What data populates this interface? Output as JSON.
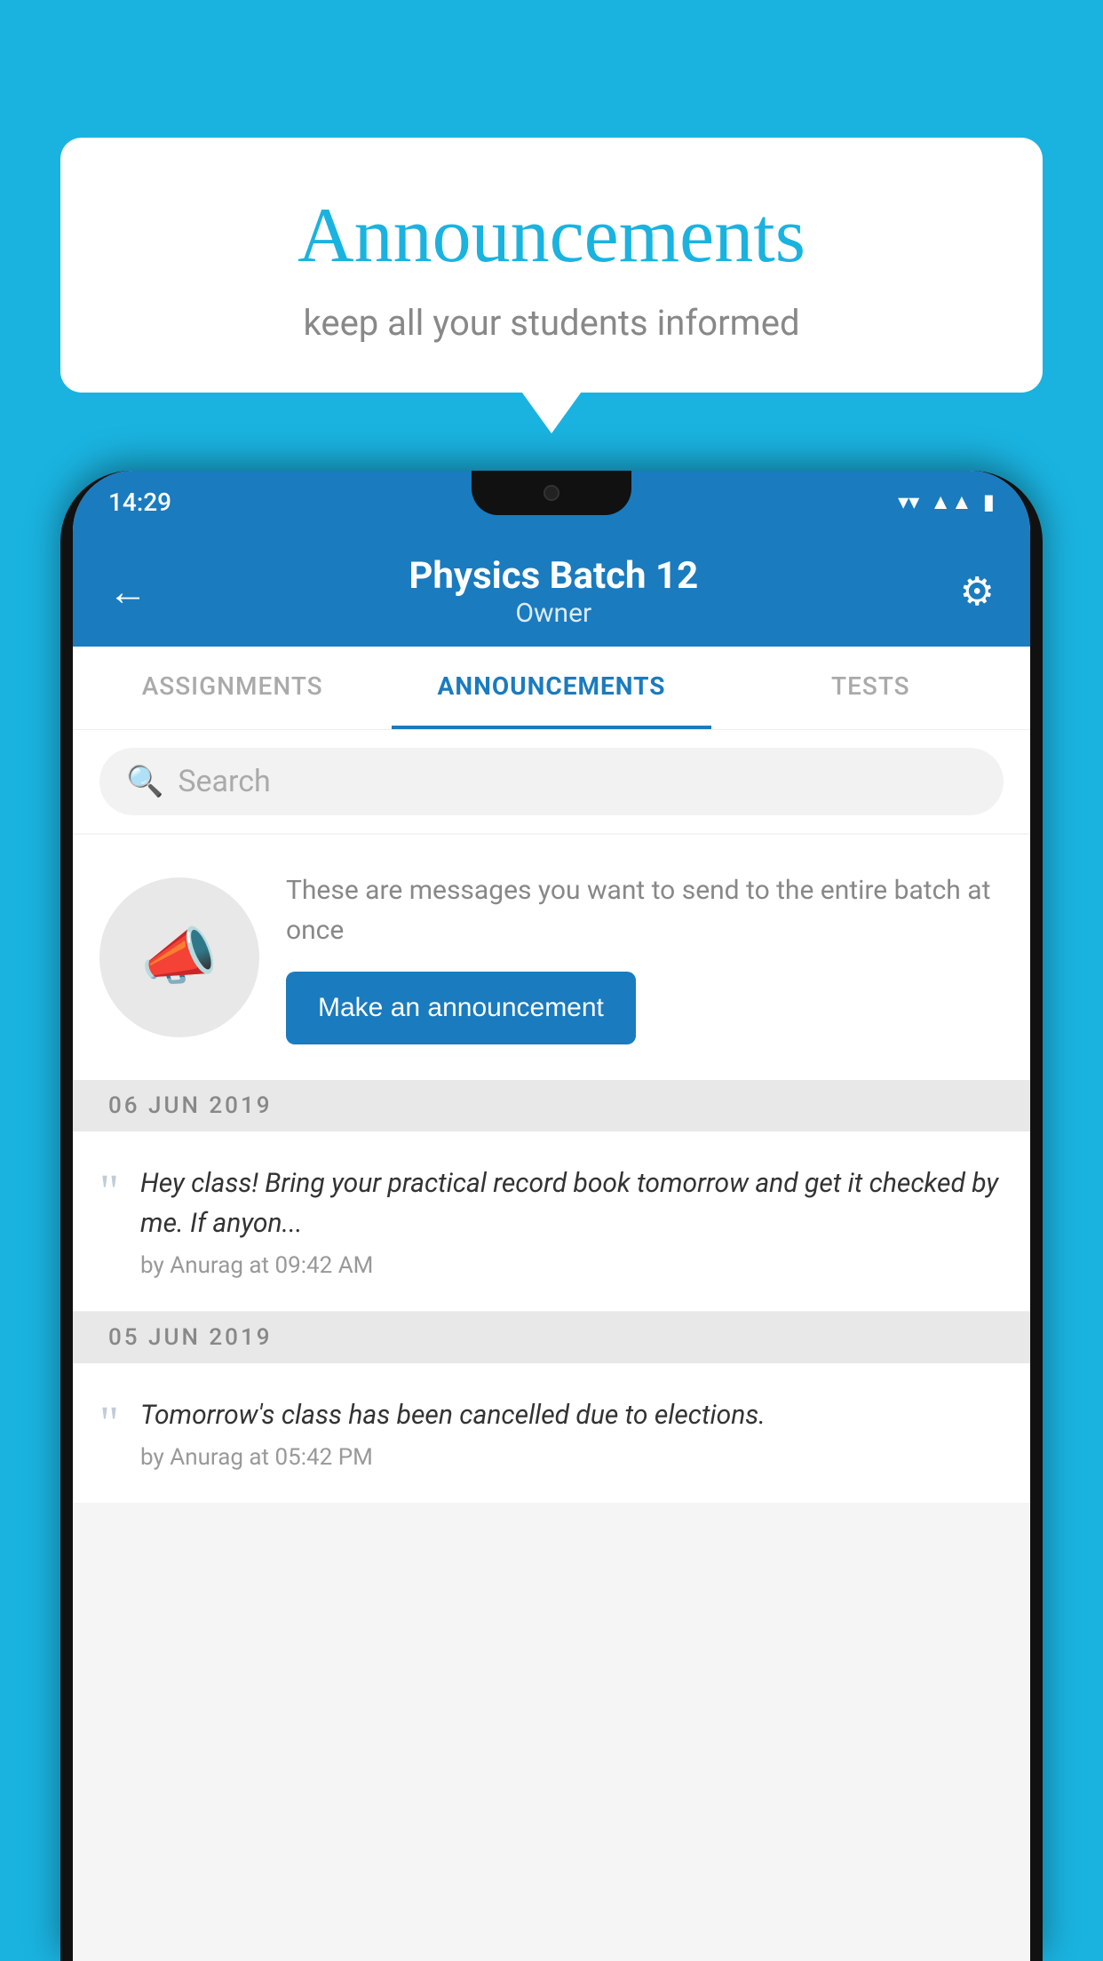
{
  "background_color": "#1ab3e0",
  "speech_bubble": {
    "title": "Announcements",
    "subtitle": "keep all your students informed"
  },
  "status_bar": {
    "time": "14:29",
    "icons": [
      "wifi",
      "signal",
      "battery"
    ]
  },
  "app_header": {
    "title": "Physics Batch 12",
    "subtitle": "Owner",
    "back_label": "←"
  },
  "tabs": [
    {
      "label": "ASSIGNMENTS",
      "active": false
    },
    {
      "label": "ANNOUNCEMENTS",
      "active": true
    },
    {
      "label": "TESTS",
      "active": false
    }
  ],
  "search": {
    "placeholder": "Search"
  },
  "announcement_prompt": {
    "description": "These are messages you want to send to the entire batch at once",
    "button_label": "Make an announcement"
  },
  "announcements": [
    {
      "date": "06  JUN  2019",
      "text": "Hey class! Bring your practical record book tomorrow and get it checked by me. If anyon...",
      "meta": "by Anurag at 09:42 AM"
    },
    {
      "date": "05  JUN  2019",
      "text": "Tomorrow's class has been cancelled due to elections.",
      "meta": "by Anurag at 05:42 PM"
    }
  ],
  "icons": {
    "back": "←",
    "gear": "⚙",
    "search": "🔍",
    "megaphone": "📣",
    "quote": "“"
  }
}
